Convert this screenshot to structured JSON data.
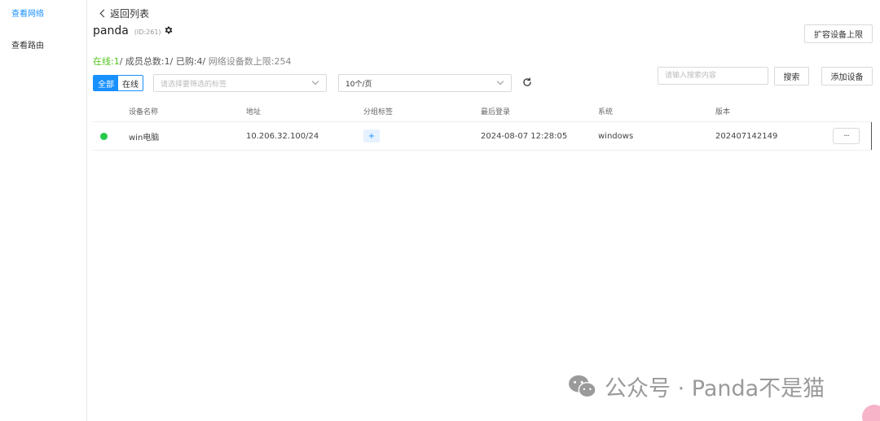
{
  "sidebar": {
    "items": [
      {
        "label": "查看网络",
        "active": true
      },
      {
        "label": "查看路由",
        "active": false
      }
    ]
  },
  "header": {
    "back_label": "返回列表",
    "network_name": "panda",
    "network_id": "(ID:261)",
    "expand_button": "扩容设备上限"
  },
  "stats": {
    "online": "在线:1",
    "members": "/ 成员总数:1/ 已购:4/",
    "limit": " 网络设备数上限:254"
  },
  "filters": {
    "segments": [
      "全部",
      "在线"
    ],
    "tag_placeholder": "请选择要筛选的标签",
    "page_size": "10个/页",
    "search_placeholder": "请输入搜索内容",
    "search_button": "搜索",
    "add_device_button": "添加设备"
  },
  "table": {
    "headers": {
      "name": "设备名称",
      "address": "地址",
      "tags": "分组标签",
      "last_login": "最后登录",
      "system": "系统",
      "version": "版本"
    },
    "rows": [
      {
        "name": "win电脑",
        "address": "10.206.32.100/24",
        "tag_add": "+",
        "last_login": "2024-08-07 12:28:05",
        "system": "windows",
        "version": "202407142149",
        "more": "···",
        "status_color": "#27c94a"
      }
    ]
  },
  "watermark": {
    "text": "公众号 · Panda不是猫"
  },
  "colors": {
    "accent": "#1890ff",
    "online": "#52c41a"
  }
}
